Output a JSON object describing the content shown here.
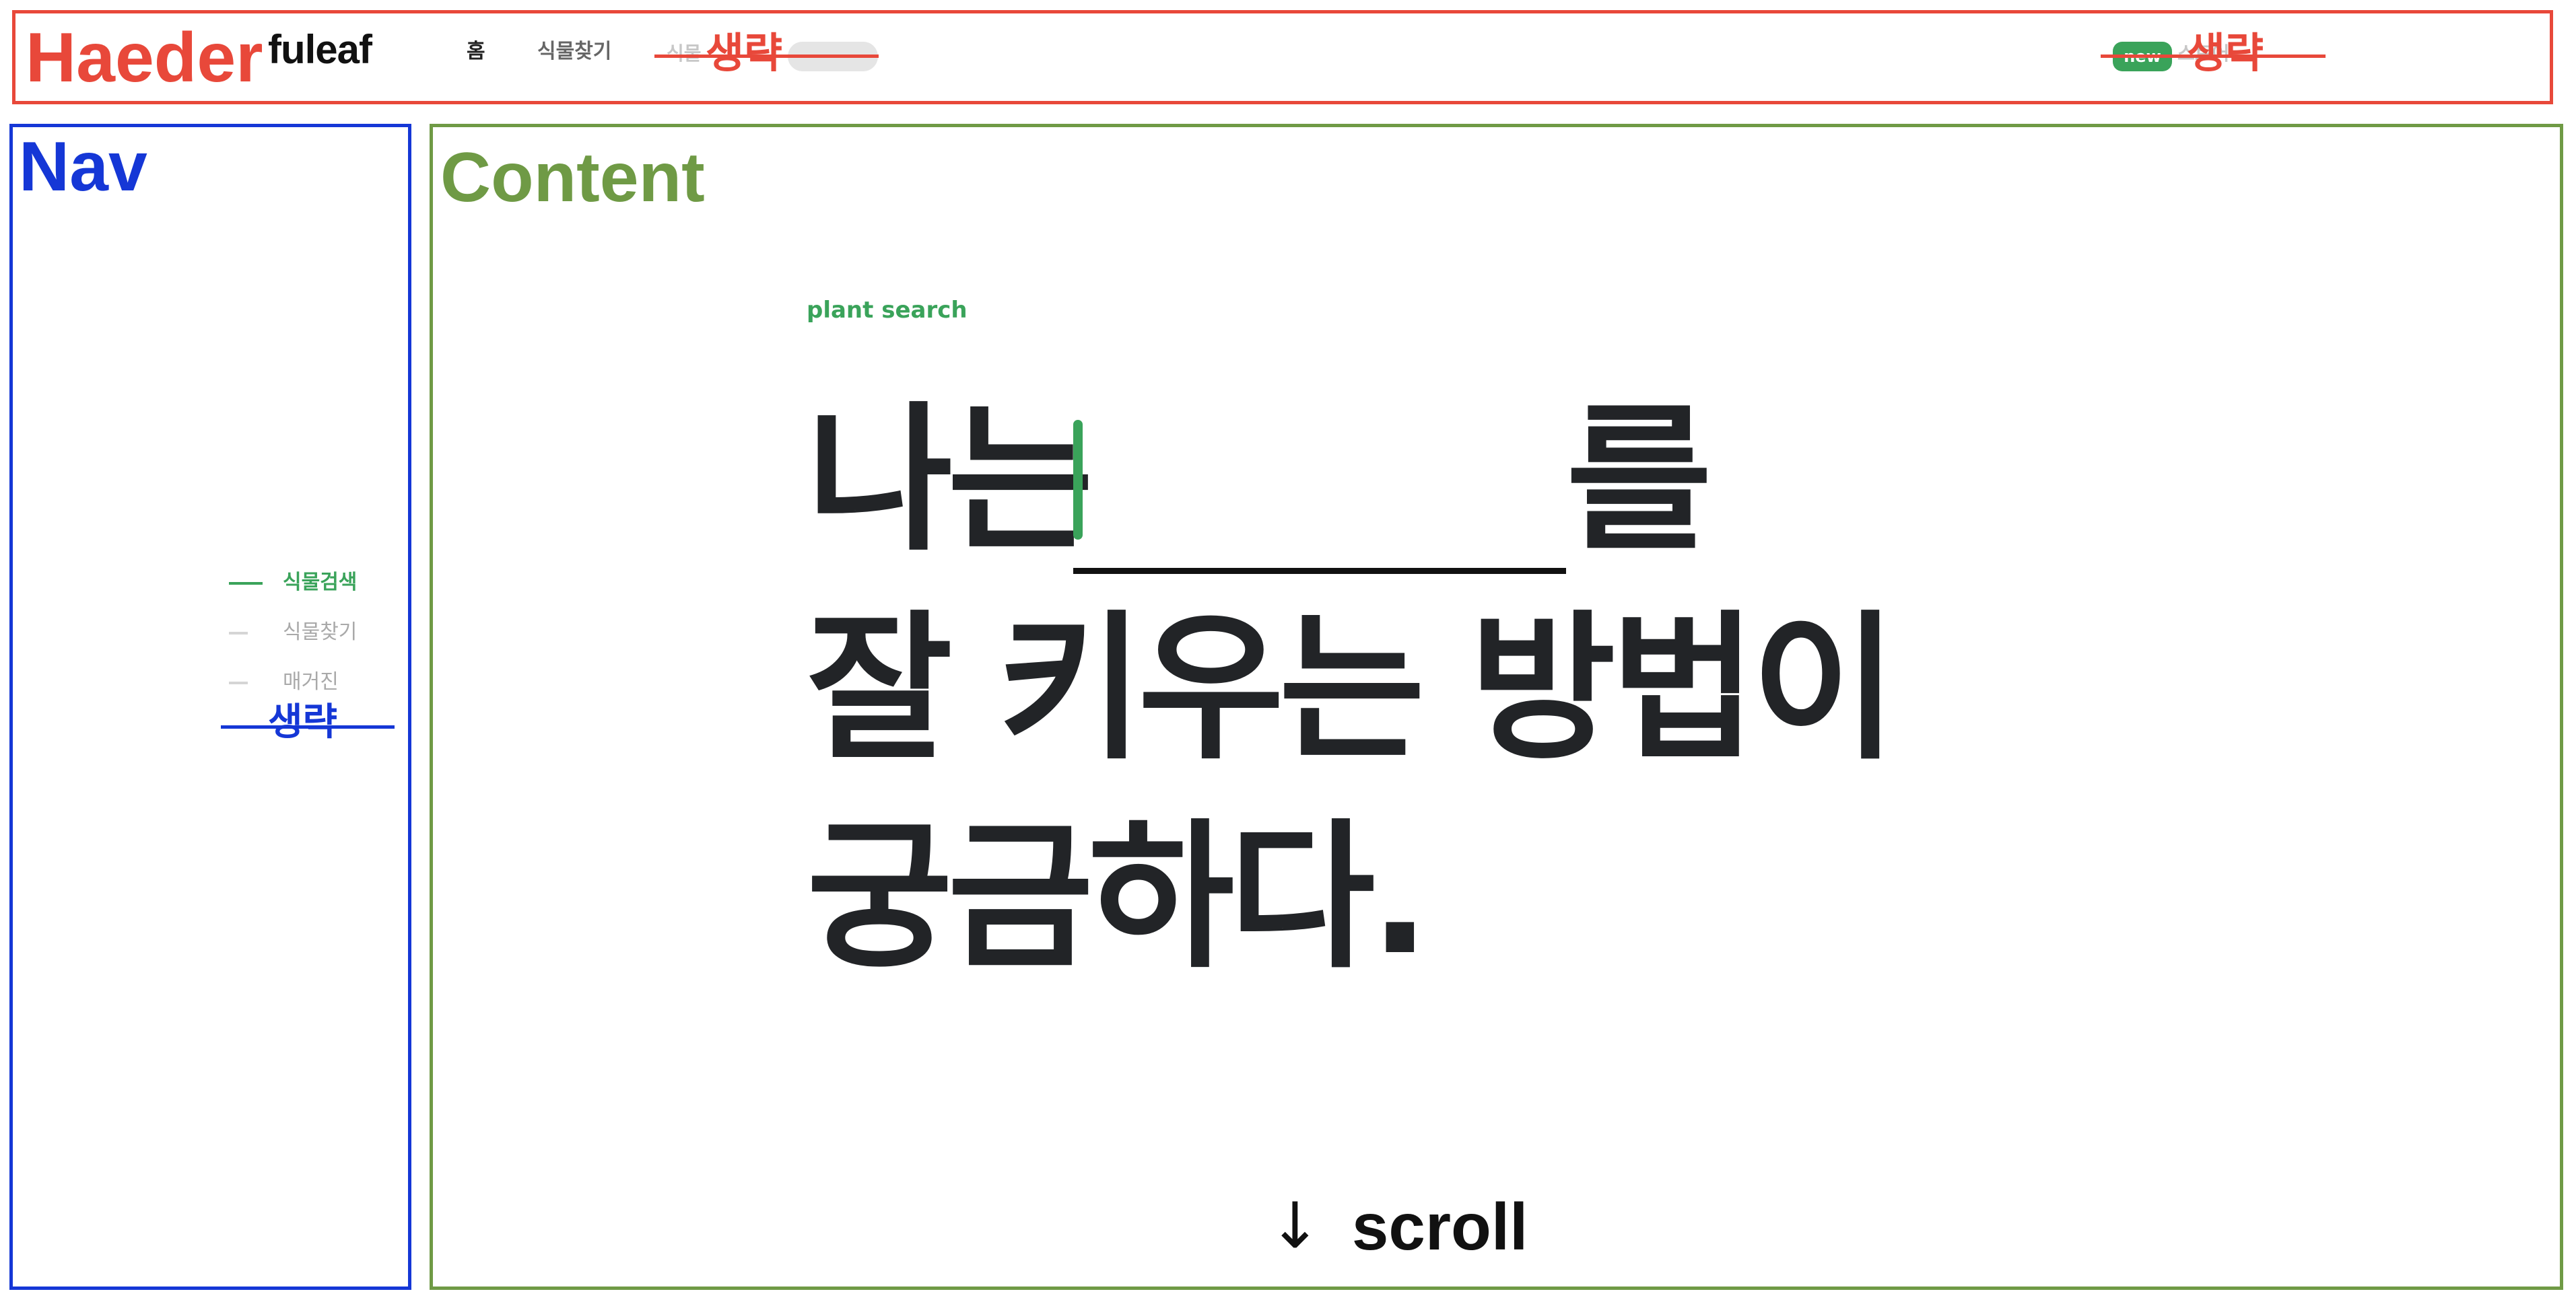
{
  "annotations": {
    "header_label": "Haeder",
    "nav_label": "Nav",
    "content_label": "Content",
    "omitted_label": "생략",
    "colors": {
      "header": "#e8483a",
      "nav": "#1537d6",
      "content": "#6f9a45"
    }
  },
  "header": {
    "logo": "fuleaf",
    "nav_items": [
      {
        "label": "홈"
      },
      {
        "label": "식물찾기"
      }
    ],
    "faded_left_text": "식물",
    "faded_right_text": "스토어",
    "badge": "new"
  },
  "sidebar": {
    "items": [
      {
        "label": "식물검색",
        "active": true
      },
      {
        "label": "식물찾기",
        "active": false
      },
      {
        "label": "매거진",
        "active": false
      }
    ]
  },
  "content": {
    "eyebrow": "plant search",
    "headline": {
      "line1_start": "나는",
      "line1_end": "를",
      "line2": "잘 키우는 방법이",
      "line3": "궁금하다."
    }
  },
  "scroll_hint": {
    "arrow": "↓",
    "label": "scroll"
  },
  "colors": {
    "accent": "#3aa35a",
    "headline": "#222427",
    "muted": "#a9a9a9"
  }
}
